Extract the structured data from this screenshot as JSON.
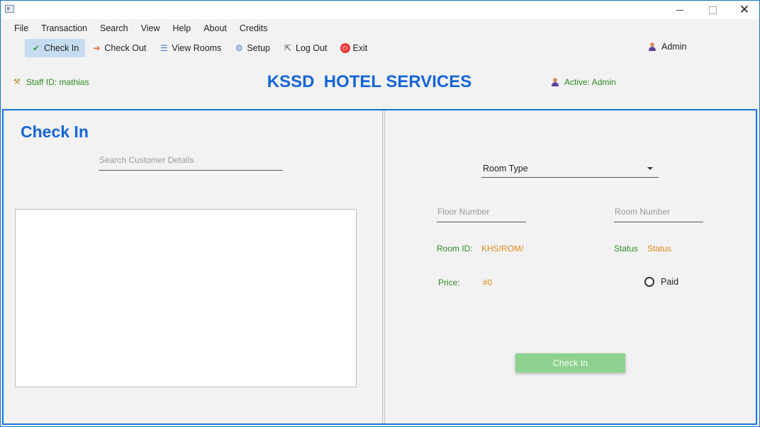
{
  "menu": [
    "File",
    "Transaction",
    "Search",
    "View",
    "Help",
    "About",
    "Credits"
  ],
  "toolbar": {
    "check_in": "Check In",
    "check_out": "Check Out",
    "view_rooms": "View Rooms",
    "setup": "Setup",
    "log_out": "Log Out",
    "exit": "Exit",
    "admin": "Admin"
  },
  "header": {
    "staff_id": "Staff ID: mathias",
    "brand": "KSSD  HOTEL SERVICES",
    "active_user": "Active: Admin"
  },
  "left": {
    "title": "Check In",
    "search_placeholder": "Search Customer Details"
  },
  "right": {
    "room_type": "Room Type",
    "floor_placeholder": "Floor Number",
    "room_number_placeholder": "Room Number",
    "room_id_label": "Room ID:",
    "room_id_value": "KHS/ROM/",
    "status_label": "Status",
    "status_value": "Status",
    "price_label": "Price:",
    "price_value": "#0",
    "paid_label": "Paid",
    "check_in_button": "Check In"
  },
  "colors": {
    "accent": "#1565d8",
    "label_green": "#2e8b22",
    "value_orange": "#e08a1a",
    "button_green": "#8fd18f"
  }
}
